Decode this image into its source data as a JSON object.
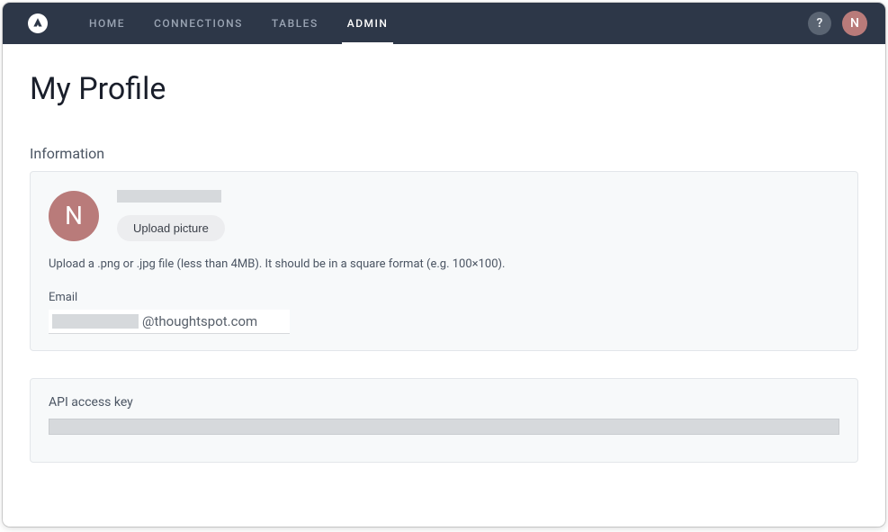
{
  "nav": {
    "items": [
      {
        "label": "HOME"
      },
      {
        "label": "CONNECTIONS"
      },
      {
        "label": "TABLES"
      },
      {
        "label": "ADMIN"
      }
    ],
    "active_index": 3
  },
  "topbar": {
    "help_glyph": "?",
    "avatar_initial": "N"
  },
  "page": {
    "title": "My Profile"
  },
  "information": {
    "section_title": "Information",
    "avatar_initial": "N",
    "upload_button": "Upload picture",
    "upload_hint": "Upload a .png or .jpg file (less than 4MB). It should be in a square format (e.g. 100×100).",
    "email_label": "Email",
    "email_local_redacted": true,
    "email_domain": "@thoughtspot.com"
  },
  "api": {
    "label": "API access key",
    "value_redacted": true
  },
  "colors": {
    "topbar_bg": "#2d3748",
    "avatar_bg": "#b97b7a",
    "card_border": "#e3e6ea",
    "card_bg": "#f7f9fa",
    "placeholder": "#d6d9dc"
  }
}
